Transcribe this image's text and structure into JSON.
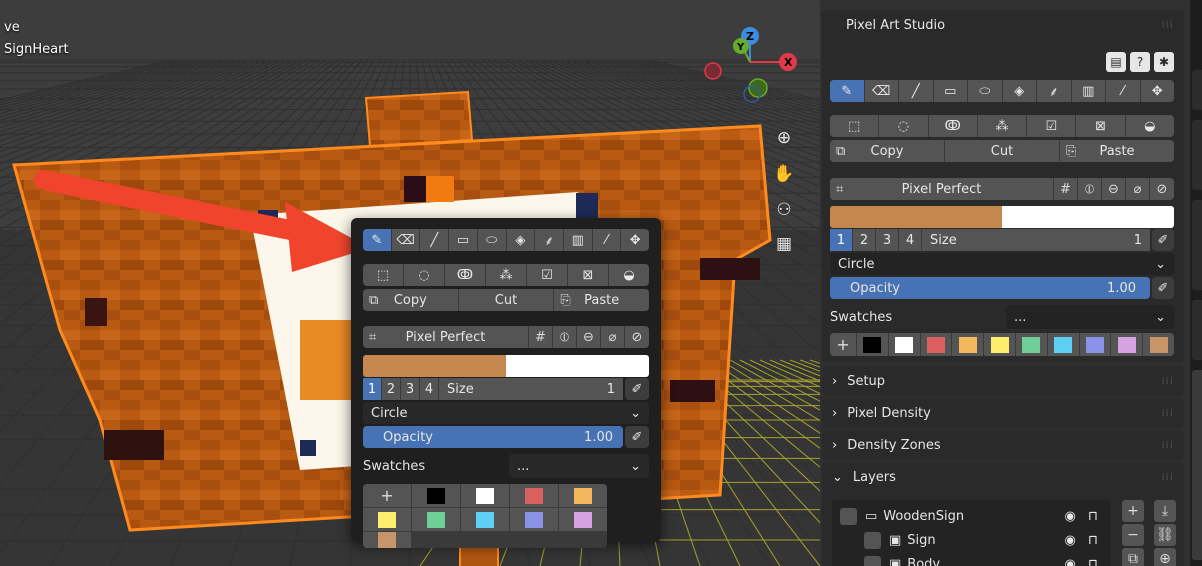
{
  "viewport": {
    "object_text_line1": "ve",
    "object_text_line2": "SignHeart",
    "gizmo_labels": {
      "z": "Z",
      "y": "Y",
      "x": "X"
    },
    "nav_icons": [
      "zoom-icon",
      "hand-icon",
      "camera-icon",
      "grid-icon"
    ]
  },
  "popup": {
    "tools": [
      {
        "icon": "brush-icon",
        "glyph": "✎",
        "active": true
      },
      {
        "icon": "eraser-icon",
        "glyph": "⌫",
        "active": false
      },
      {
        "icon": "line-icon",
        "glyph": "╱",
        "active": false
      },
      {
        "icon": "rectangle-icon",
        "glyph": "▭",
        "active": false
      },
      {
        "icon": "ellipse-icon",
        "glyph": "⬭",
        "active": false
      },
      {
        "icon": "fill-bucket-icon",
        "glyph": "◈",
        "active": false
      },
      {
        "icon": "droplets-icon",
        "glyph": "⸙",
        "active": false
      },
      {
        "icon": "gradient-icon",
        "glyph": "▥",
        "active": false
      },
      {
        "icon": "eyedropper-icon",
        "glyph": "⁄",
        "active": false
      },
      {
        "icon": "move-icon",
        "glyph": "✥",
        "active": false
      }
    ],
    "selection_tools": [
      {
        "icon": "rect-select-icon",
        "glyph": "⬚"
      },
      {
        "icon": "circle-select-icon",
        "glyph": "◌"
      },
      {
        "icon": "lasso-select-icon",
        "glyph": "ↂ"
      },
      {
        "icon": "magic-wand-icon",
        "glyph": "⁂"
      },
      {
        "icon": "checkbox-icon",
        "glyph": "☑"
      },
      {
        "icon": "select-all-icon",
        "glyph": "⊠"
      },
      {
        "icon": "invert-select-icon",
        "glyph": "◒"
      }
    ],
    "copy_label": "Copy",
    "cut_label": "Cut",
    "paste_label": "Paste",
    "pixel_perfect_label": "Pixel Perfect",
    "primary_color": "#c4884e",
    "secondary_color": "#ffffff",
    "size_presets": [
      "1",
      "2",
      "3",
      "4"
    ],
    "active_preset": 0,
    "size_label": "Size",
    "size_value": "1",
    "shape_value": "Circle",
    "opacity_label": "Opacity",
    "opacity_value": "1.00",
    "opacity_fraction": 1.0,
    "swatches_label": "Swatches",
    "swatches_select": "...",
    "swatch_colors": [
      "#000000",
      "#ffffff",
      "#d9605e",
      "#f5b75e",
      "#ffee6e",
      "#6fcf97",
      "#5fd0f5",
      "#8b93e8",
      "#d6a3e0",
      "#c79567"
    ]
  },
  "sidebar": {
    "title": "Pixel Art Studio",
    "header_icons": [
      "notebook-icon",
      "help-icon",
      "bug-icon"
    ],
    "panels": [
      {
        "label": "Setup"
      },
      {
        "label": "Pixel Density"
      },
      {
        "label": "Density Zones"
      },
      {
        "label": "Layers"
      }
    ],
    "layers": [
      {
        "name": "WoodenSign",
        "indent": 0,
        "icon": "folder-icon"
      },
      {
        "name": "Sign",
        "indent": 1,
        "icon": "image-icon"
      },
      {
        "name": "Body",
        "indent": 1,
        "icon": "image-icon"
      }
    ],
    "layer_buttons": [
      "+",
      "−",
      "⧉"
    ]
  },
  "colors": {
    "accent": "#4772b3",
    "arrow": "#f0452c",
    "frame_outline": "#ff8a1e"
  }
}
